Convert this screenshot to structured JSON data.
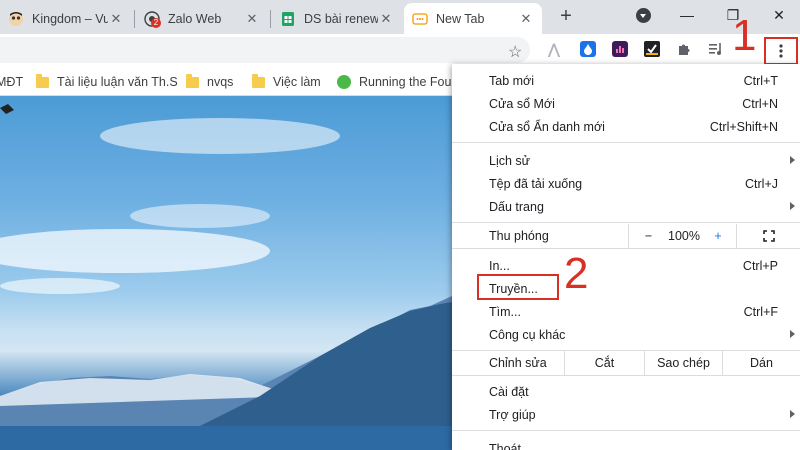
{
  "tabs": [
    {
      "title": "Kingdom – Vu",
      "icon": "app-icon",
      "active": false
    },
    {
      "title": "Zalo Web",
      "icon": "zalo-icon",
      "badge": "2",
      "active": false
    },
    {
      "title": "DS bài renew",
      "icon": "sheets-icon",
      "active": false
    },
    {
      "title": "New Tab",
      "icon": "newtab-icon",
      "active": true
    }
  ],
  "window": {
    "minimize": "—",
    "maximize": "❐",
    "close": "✕"
  },
  "new_tab": "+",
  "bookmarks": [
    {
      "label": "MĐT",
      "icon": "none"
    },
    {
      "label": "Tài liệu luận văn Th.S",
      "icon": "folder-icon"
    },
    {
      "label": "nvqs",
      "icon": "folder-icon"
    },
    {
      "label": "Việc làm",
      "icon": "folder-icon"
    },
    {
      "label": "Running the Four",
      "icon": "green-circle-icon"
    }
  ],
  "menu": {
    "items": [
      {
        "label": "Tab mới",
        "shortcut": "Ctrl+T"
      },
      {
        "label": "Cửa sổ Mới",
        "shortcut": "Ctrl+N"
      },
      {
        "label": "Cửa sổ Ẩn danh mới",
        "shortcut": "Ctrl+Shift+N"
      },
      {
        "label": "Lịch sử",
        "shortcut": ""
      },
      {
        "label": "Tệp đã tải xuống",
        "shortcut": "Ctrl+J"
      },
      {
        "label": "Dấu trang",
        "shortcut": ""
      },
      {
        "label": "In...",
        "shortcut": "Ctrl+P"
      },
      {
        "label": "Truyền...",
        "shortcut": ""
      },
      {
        "label": "Tìm...",
        "shortcut": "Ctrl+F"
      },
      {
        "label": "Công cụ khác",
        "shortcut": ""
      },
      {
        "label": "Cài đặt",
        "shortcut": ""
      },
      {
        "label": "Trợ giúp",
        "shortcut": ""
      },
      {
        "label": "Thoát",
        "shortcut": ""
      }
    ],
    "zoom": {
      "label": "Thu phóng",
      "minus": "−",
      "value": "100%",
      "plus": "+"
    },
    "edit": {
      "label": "Chỉnh sửa",
      "cut": "Cắt",
      "copy": "Sao chép",
      "paste": "Dán"
    }
  },
  "annotations": {
    "step1": "1",
    "step2": "2"
  },
  "colors": {
    "annotation": "#d93025",
    "tabstrip": "#dee1e6"
  }
}
